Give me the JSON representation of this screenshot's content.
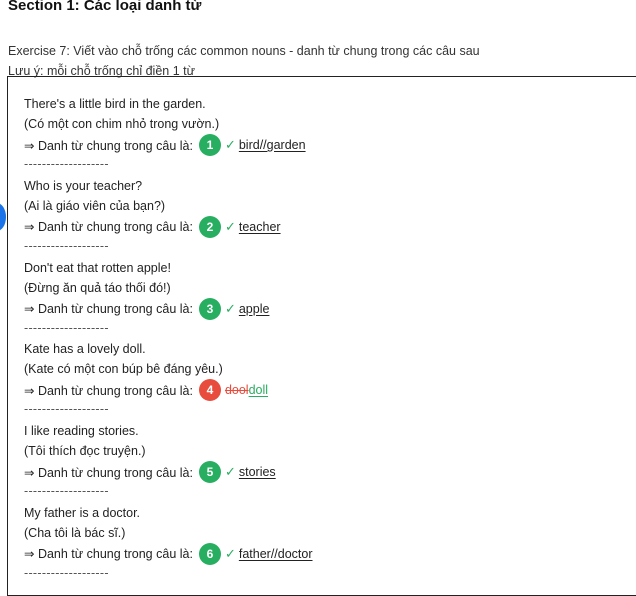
{
  "section_title": "Section 1: Các loại danh từ",
  "instructions": {
    "line1": "Exercise 7: Viết vào chỗ trống các common nouns - danh từ chung trong các câu sau",
    "line2": "Lưu ý: mỗi chỗ trống chỉ điền 1 từ"
  },
  "answer_prompt": "⇒ Danh từ chung trong câu là:",
  "separator": "-------------------",
  "check_icon": "✓",
  "colors": {
    "correct": "#27ae60",
    "wrong": "#e74c3c",
    "side_dot": "#1a73e8"
  },
  "items": [
    {
      "sentence": "There's a little bird in the garden.",
      "translation": "(Có một con chim nhỏ trong vườn.)",
      "number": "1",
      "status": "correct",
      "answer": "bird//garden"
    },
    {
      "sentence": "Who is your teacher?",
      "translation": "(Ai là giáo viên của bạn?)",
      "number": "2",
      "status": "correct",
      "answer": "teacher"
    },
    {
      "sentence": "Don't eat that rotten apple!",
      "translation": "(Đừng ăn quả táo thối đó!)",
      "number": "3",
      "status": "correct",
      "answer": "apple"
    },
    {
      "sentence": "Kate has a lovely doll.",
      "translation": "(Kate có một con búp bê đáng yêu.)",
      "number": "4",
      "status": "wrong",
      "wrong_answer": "dool",
      "correct_answer": "doll"
    },
    {
      "sentence": "I like reading stories.",
      "translation": "(Tôi thích đọc truyện.)",
      "number": "5",
      "status": "correct",
      "answer": "stories"
    },
    {
      "sentence": "My father is a doctor.",
      "translation": "(Cha tôi là bác sĩ.)",
      "number": "6",
      "status": "correct",
      "answer": "father//doctor"
    }
  ]
}
